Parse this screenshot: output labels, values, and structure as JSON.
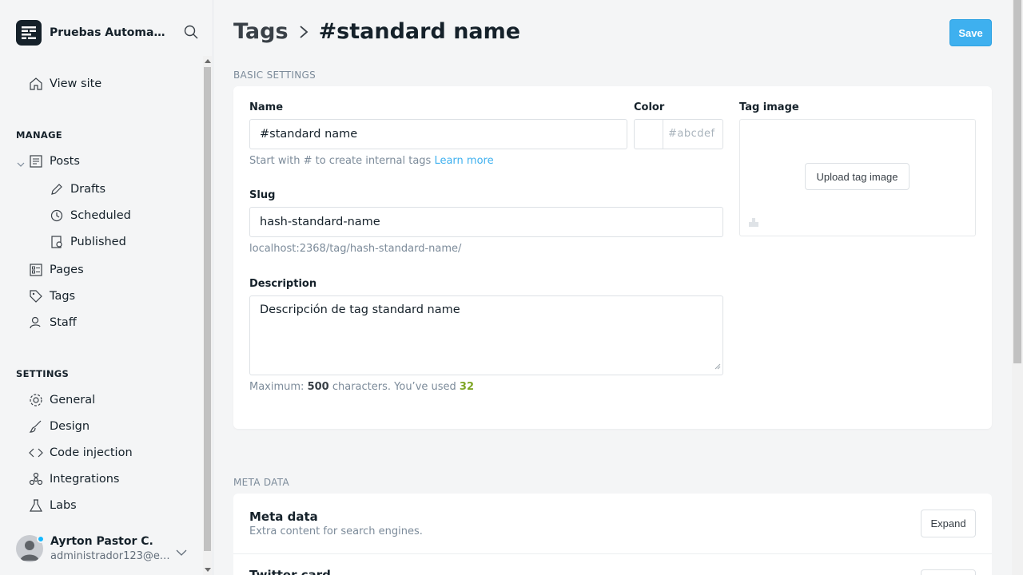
{
  "sidebar": {
    "site_title": "Pruebas Automati...",
    "view_site": "View site",
    "manage_label": "MANAGE",
    "posts": "Posts",
    "drafts": "Drafts",
    "scheduled": "Scheduled",
    "published": "Published",
    "pages": "Pages",
    "tags": "Tags",
    "staff": "Staff",
    "settings_label": "SETTINGS",
    "general": "General",
    "design": "Design",
    "code_injection": "Code injection",
    "integrations": "Integrations",
    "labs": "Labs",
    "user_name": "Ayrton Pastor C.",
    "user_email": "administrador123@exa..."
  },
  "header": {
    "crumb_parent": "Tags",
    "crumb_current": "#standard name",
    "save_label": "Save"
  },
  "basic": {
    "section_label": "BASIC SETTINGS",
    "name_label": "Name",
    "name_value": "#standard name",
    "name_hint": "Start with # to create internal tags",
    "learn_more": "Learn more",
    "color_label": "Color",
    "color_placeholder": "#abcdef",
    "slug_label": "Slug",
    "slug_value": "hash-standard-name",
    "slug_url": "localhost:2368/tag/hash-standard-name/",
    "description_label": "Description",
    "description_value": "Descripción de tag standard name",
    "counter_prefix": "Maximum:",
    "counter_max": "500",
    "counter_mid": "characters. You’ve used",
    "counter_used": "32",
    "tag_image_label": "Tag image",
    "upload_label": "Upload tag image"
  },
  "meta": {
    "section_label": "META DATA",
    "title": "Meta data",
    "subtitle": "Extra content for search engines.",
    "expand_label": "Expand",
    "next_title": "Twitter card"
  },
  "colors": {
    "accent": "#3eb0ef",
    "counter_ok": "#7fa626"
  }
}
